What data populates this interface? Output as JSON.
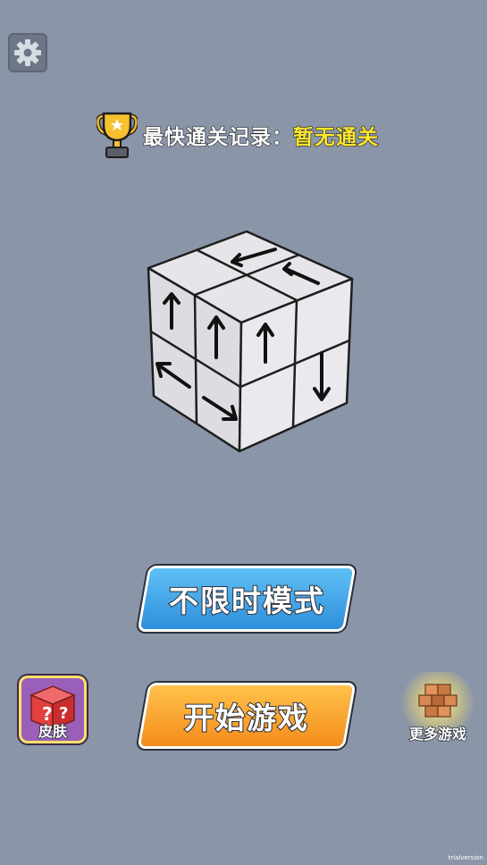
{
  "record": {
    "label": "最快通关记录：",
    "value": "暂无通关"
  },
  "buttons": {
    "timeless": "不限时模式",
    "start": "开始游戏"
  },
  "skin": {
    "label": "皮肤"
  },
  "more_games": {
    "label": "更多游戏"
  },
  "watermark": "trialversion",
  "icons": {
    "settings": "gear-icon",
    "trophy": "trophy-icon",
    "skin": "question-cube-icon",
    "more": "wood-blocks-icon"
  }
}
